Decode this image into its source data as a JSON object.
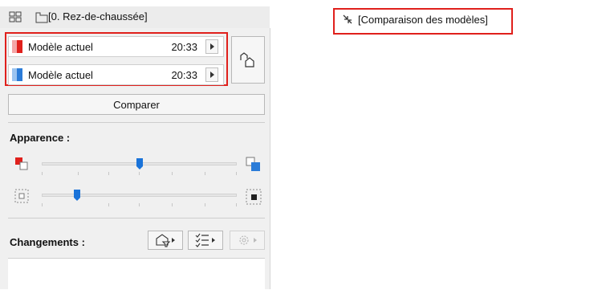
{
  "header": {
    "story_label": "[0. Rez-de-chaussée]",
    "compare_window_label": "[Comparaison des modèles]"
  },
  "models": [
    {
      "label": "Modèle actuel",
      "time": "20:33",
      "color": "#e0201c",
      "light_color": "#f4a6a6"
    },
    {
      "label": "Modèle actuel",
      "time": "20:33",
      "color": "#2b7cd8",
      "light_color": "#9cc4f0"
    }
  ],
  "compare_button": {
    "label": "Comparer"
  },
  "appearance": {
    "label": "Apparence :",
    "slider1_value": 0.5,
    "slider2_value": 0.18
  },
  "changes": {
    "label": "Changements :"
  },
  "colors": {
    "highlight": "#e0201c",
    "accent": "#1a73d9"
  }
}
